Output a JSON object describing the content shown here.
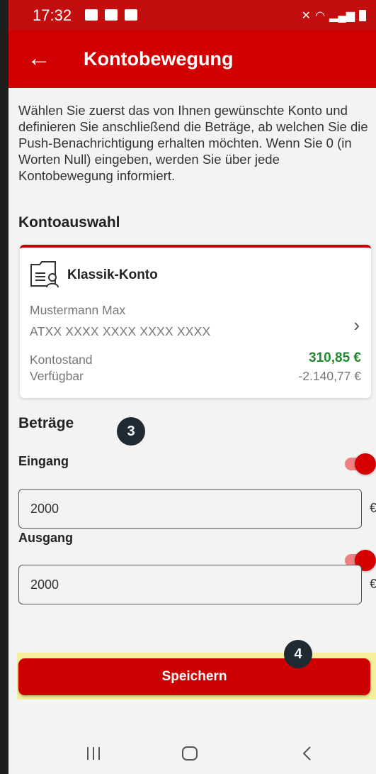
{
  "status_bar": {
    "time": "17:32"
  },
  "app_bar": {
    "back_icon": "arrow-left-icon",
    "title": "Kontobewegung"
  },
  "intro": "Wählen Sie zuerst das von Ihnen gewünschte Konto und definieren Sie anschließend die Beträge, ab welchen Sie die Push-Benachrichtigung erhalten möchten. Wenn Sie 0 (in Worten Null) eingeben, werden Sie über jede Kontobewegung informiert.",
  "account_section": {
    "title": "Kontoauswahl",
    "card": {
      "icon": "account-document-icon",
      "name": "Klassik-Konto",
      "holder": "Mustermann Max",
      "iban": "ATXX XXXX XXXX XXXX XXXX",
      "balance_label": "Kontostand",
      "balance_value": "310,85 €",
      "available_label": "Verfügbar",
      "available_value": "-2.140,77 €"
    }
  },
  "amounts_section": {
    "title": "Beträge",
    "badge": "3",
    "incoming": {
      "label": "Eingang",
      "toggle_on": true,
      "value": "2000",
      "unit": "€"
    },
    "outgoing": {
      "label": "Ausgang",
      "toggle_on": true,
      "value": "2000",
      "unit": "€"
    }
  },
  "save": {
    "badge": "4",
    "label": "Speichern"
  },
  "colors": {
    "accent": "#d10000",
    "positive": "#1f8a2e",
    "highlight": "#f3ef9c",
    "badge": "#1f2a33"
  }
}
